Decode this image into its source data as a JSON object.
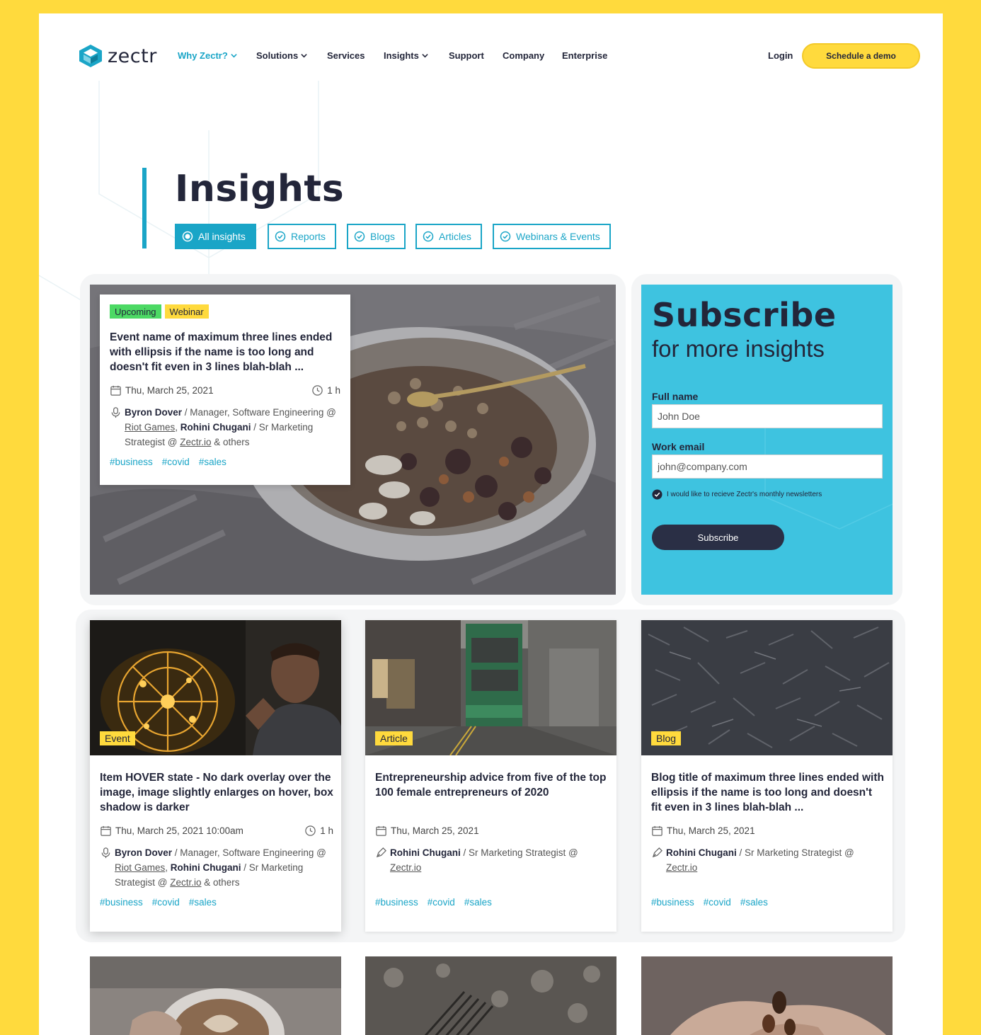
{
  "nav": {
    "logo_text": "zectr",
    "items": [
      {
        "label": "Why Zectr?",
        "has_dropdown": true,
        "active": true
      },
      {
        "label": "Solutions",
        "has_dropdown": true
      },
      {
        "label": "Services",
        "has_dropdown": false
      },
      {
        "label": "Insights",
        "has_dropdown": true
      },
      {
        "label": "Support",
        "has_dropdown": false
      },
      {
        "label": "Company",
        "has_dropdown": false
      },
      {
        "label": "Enterprise",
        "has_dropdown": false
      }
    ],
    "login": "Login",
    "cta": "Schedule a demo"
  },
  "header": {
    "title": "Insights",
    "filters": [
      {
        "label": "All insights",
        "selected": true
      },
      {
        "label": "Reports"
      },
      {
        "label": "Blogs"
      },
      {
        "label": "Articles"
      },
      {
        "label": "Webinars & Events"
      }
    ]
  },
  "featured": {
    "badges": [
      "Upcoming",
      "Webinar"
    ],
    "title": "Event name of maximum three lines ended with ellipsis if the name is too long and doesn't fit even in 3 lines blah-blah ...",
    "date": "Thu, March 25, 2021",
    "duration": "1 h",
    "speakers": {
      "name1": "Byron Dover",
      "role1": " / Manager, Software Engineering @ ",
      "org1": "Riot Games",
      "sep": ", ",
      "name2": "Rohini Chugani",
      "role2": " / Sr Marketing Strategist @ ",
      "org2": "Zectr.io",
      "tail": " & others"
    },
    "tags": [
      "#business",
      "#covid",
      "#sales"
    ]
  },
  "subscribe": {
    "title": "Subscribe",
    "subtitle": "for more insights",
    "full_name_label": "Full name",
    "full_name_value": "John Doe",
    "email_label": "Work email",
    "email_value": "john@company.com",
    "checkbox_label": "I would like to recieve Zectr's monthly newsletters",
    "button": "Subscribe"
  },
  "cards": [
    {
      "badge": "Event",
      "title": "Item HOVER state - No dark overlay over the image, image slightly enlarges on hover, box shadow is darker",
      "date": "Thu, March 25, 2021 10:00am",
      "duration": "1 h",
      "name1": "Byron Dover",
      "role1": " / Manager, Software Engineering @ ",
      "org1": "Riot Games",
      "sep": ", ",
      "name2": "Rohini Chugani",
      "role2": " / Sr Marketing Strategist @ ",
      "org2": "Zectr.io",
      "tail": " & others",
      "tags": [
        "#business",
        "#covid",
        "#sales"
      ]
    },
    {
      "badge": "Article",
      "title": "Entrepreneurship advice from five of the top 100 female entrepreneurs of 2020",
      "date": "Thu, March 25, 2021",
      "name": "Rohini Chugani",
      "role": " / Sr Marketing Strategist @ ",
      "org": "Zectr.io",
      "tags": [
        "#business",
        "#covid",
        "#sales"
      ]
    },
    {
      "badge": "Blog",
      "title": "Blog title of maximum three lines ended with ellipsis if the name is too long and doesn't fit even in 3 lines blah-blah ...",
      "date": "Thu, March 25, 2021",
      "name": "Rohini Chugani",
      "role": " / Sr Marketing Strategist @ ",
      "org": "Zectr.io",
      "tags": [
        "#business",
        "#covid",
        "#sales"
      ]
    }
  ],
  "colors": {
    "brand_teal": "#1AA5C7",
    "accent_yellow": "#FFDA3D",
    "subscribe_bg": "#3EC3E0",
    "dark": "#23263A"
  }
}
